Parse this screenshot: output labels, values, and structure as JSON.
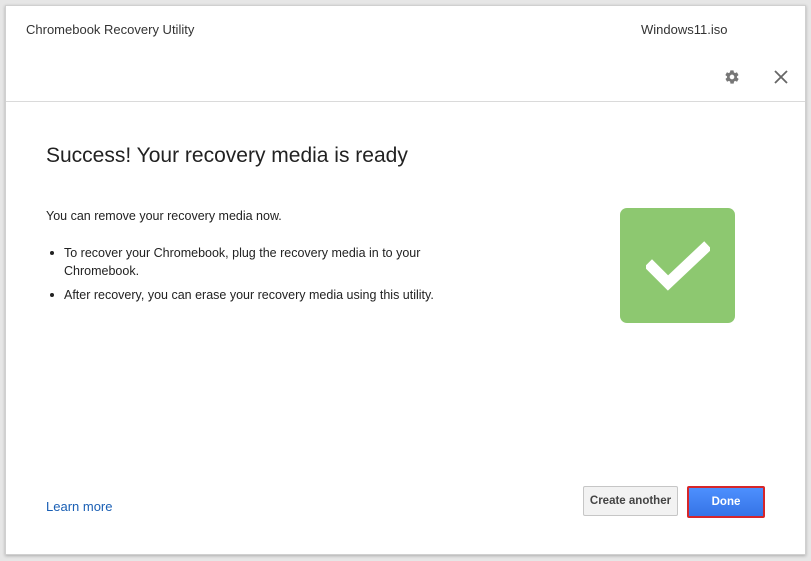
{
  "window": {
    "app_title": "Chromebook Recovery Utility",
    "file_name": "Windows11.iso",
    "icons": {
      "settings": "gear-icon",
      "close": "close-icon"
    }
  },
  "main": {
    "heading": "Success! Your recovery media is ready",
    "intro": "You can remove your recovery media now.",
    "bullets": [
      "To recover your Chromebook, plug the recovery media in to your Chromebook.",
      "After recovery, you can erase your recovery media using this utility."
    ],
    "status_icon": "checkmark-icon"
  },
  "footer": {
    "learn_more": "Learn more",
    "create_another": "Create another",
    "done": "Done"
  },
  "colors": {
    "success_green": "#8dc870",
    "link_blue": "#1a5fb4",
    "primary_blue": "#4285f4",
    "highlight_red": "#d6262a"
  }
}
